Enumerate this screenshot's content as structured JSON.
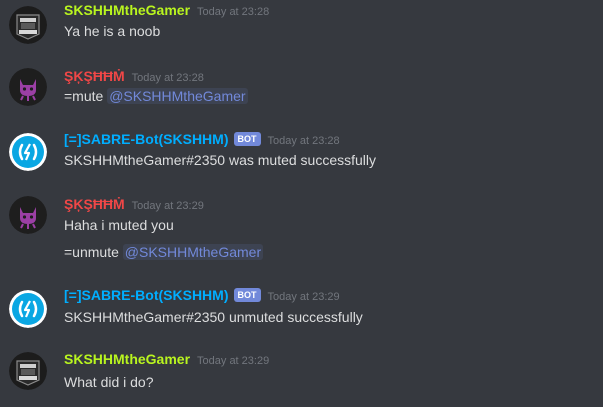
{
  "colors": {
    "gamer_name": "#b9f51f",
    "skshhm_name": "#f04747",
    "bot_name": "#00aeff",
    "mention": "#7289da",
    "bot_tag": "#7289da",
    "background": "#36393f"
  },
  "messages": [
    {
      "author": "SKSHHMtheGamer",
      "timestamp": "Today at 23:28",
      "avatar_icon": "gamer-avatar-icon",
      "lines": [
        {
          "text": "Ya he is a noob"
        }
      ]
    },
    {
      "author": "ŞĶŞĦĦṀ",
      "timestamp": "Today at 23:28",
      "avatar_icon": "octocat-avatar-icon",
      "lines": [
        {
          "text": "=mute ",
          "mention": "@SKSHHMtheGamer"
        }
      ]
    },
    {
      "author": "[=]SABRE-Bot(SKSHHM)",
      "bot_tag": "BOT",
      "timestamp": "Today at 23:28",
      "avatar_icon": "bot-avatar-icon",
      "lines": [
        {
          "text": "SKSHHMtheGamer#2350 was muted successfully"
        }
      ]
    },
    {
      "author": "ŞĶŞĦĦṀ",
      "timestamp": "Today at 23:29",
      "avatar_icon": "octocat-avatar-icon",
      "lines": [
        {
          "text": "Haha i muted you"
        },
        {
          "text": "=unmute ",
          "mention": "@SKSHHMtheGamer"
        }
      ]
    },
    {
      "author": "[=]SABRE-Bot(SKSHHM)",
      "bot_tag": "BOT",
      "timestamp": "Today at 23:29",
      "avatar_icon": "bot-avatar-icon",
      "lines": [
        {
          "text": "SKSHHMtheGamer#2350 unmuted successfully"
        }
      ]
    },
    {
      "author": "SKSHHMtheGamer",
      "timestamp": "Today at 23:29",
      "avatar_icon": "gamer-avatar-icon",
      "lines": [
        {
          "text": "What did i do?"
        }
      ]
    }
  ]
}
